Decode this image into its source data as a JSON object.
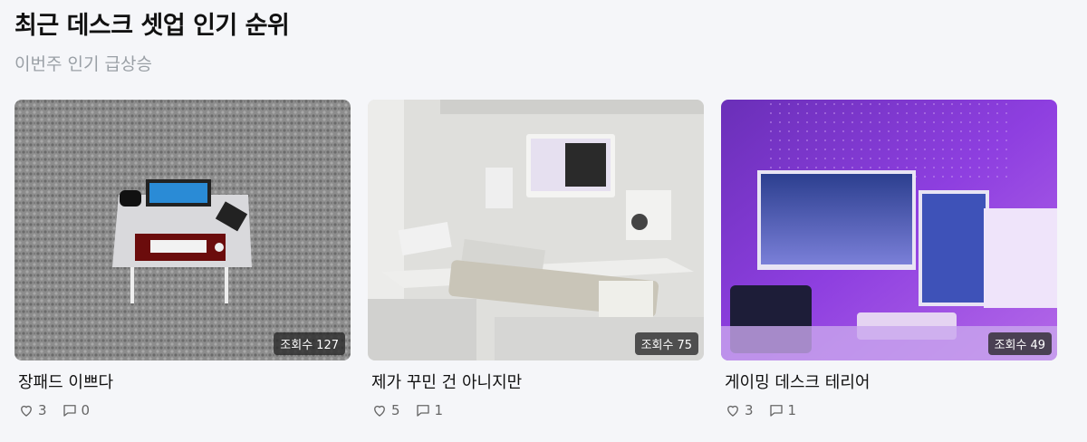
{
  "header": {
    "title": "최근 데스크 셋업 인기 순위",
    "subtitle": "이번주 인기 급상승"
  },
  "cards": [
    {
      "title": "장패드 이쁘다",
      "views_label": "조회수",
      "views": "127",
      "likes": "3",
      "comments": "0"
    },
    {
      "title": "제가 꾸민 건 아니지만",
      "views_label": "조회수",
      "views": "75",
      "likes": "5",
      "comments": "1"
    },
    {
      "title": "게이밍 데스크 테리어",
      "views_label": "조회수",
      "views": "49",
      "likes": "3",
      "comments": "1"
    }
  ],
  "icons": {
    "like": "heart-outline-icon",
    "comment": "speech-bubble-icon"
  }
}
